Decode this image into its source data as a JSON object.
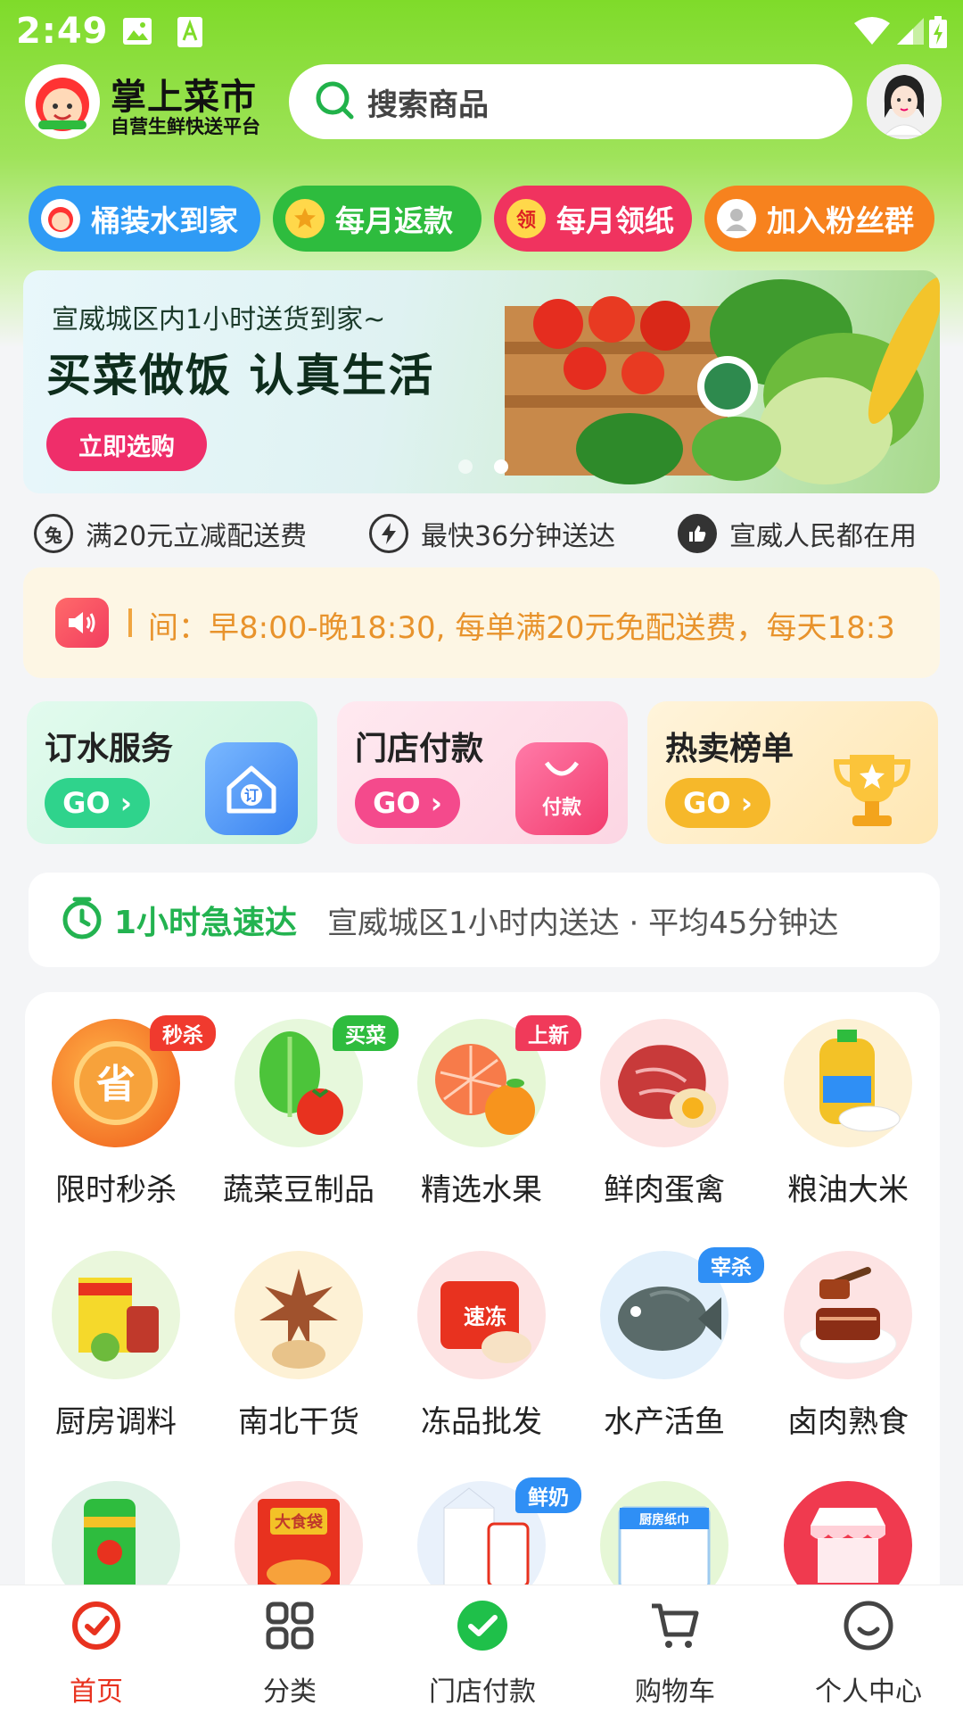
{
  "status_bar": {
    "time": "2:49"
  },
  "header": {
    "app_name": "掌上菜市",
    "app_subtitle": "自营生鲜快送平台",
    "search_placeholder": "搜索商品"
  },
  "quick_pills": [
    {
      "label": "桶装水到家",
      "color": "#2f9bf5"
    },
    {
      "label": "每月返款",
      "color": "#2ebc3e"
    },
    {
      "label": "每月领纸",
      "color": "#f0335f",
      "icon_text": "领"
    },
    {
      "label": "加入粉丝群",
      "color": "#f7821e"
    }
  ],
  "banner": {
    "line1": "宣威城区内1小时送货到家~",
    "line2": "买菜做饭 认真生活",
    "button": "立即选购"
  },
  "features": [
    {
      "icon_text": "兔",
      "label": "满20元立减配送费",
      "icon": "free-shipping-icon"
    },
    {
      "label": "最快36分钟送达",
      "icon": "lightning-icon"
    },
    {
      "label": "宣威人民都在用",
      "icon": "thumbs-up-icon"
    }
  ],
  "notice": {
    "text": "间：早8:00-晚18:30, 每单满20元免配送费，每天18:3"
  },
  "service_cards": [
    {
      "title": "订水服务",
      "go": "GO",
      "icon_text": "订",
      "color": "#2fd38c"
    },
    {
      "title": "门店付款",
      "go": "GO",
      "icon_text": "付款",
      "color": "#f44a8c"
    },
    {
      "title": "热卖榜单",
      "go": "GO",
      "color": "#f6b82a"
    }
  ],
  "express": {
    "title": "1小时急速达",
    "desc": "宣威城区1小时内送达 · 平均45分钟达"
  },
  "categories": [
    {
      "label": "限时秒杀",
      "badge": "秒杀",
      "badge_color": "#f03a2e",
      "icon_text": "省"
    },
    {
      "label": "蔬菜豆制品",
      "badge": "买菜",
      "badge_color": "#2ebc3e"
    },
    {
      "label": "精选水果",
      "badge": "上新",
      "badge_color": "#f03a5a"
    },
    {
      "label": "鲜肉蛋禽"
    },
    {
      "label": "粮油大米"
    },
    {
      "label": "厨房调料"
    },
    {
      "label": "南北干货"
    },
    {
      "label": "冻品批发",
      "icon_text": "速冻"
    },
    {
      "label": "水产活鱼",
      "badge": "宰杀",
      "badge_color": "#2f8ff5"
    },
    {
      "label": "卤肉熟食"
    },
    {
      "label": ""
    },
    {
      "label": "",
      "icon_text": "大食袋"
    },
    {
      "label": "",
      "badge": "鲜奶",
      "badge_color": "#2f8ff5"
    },
    {
      "label": "",
      "icon_text": "厨房纸巾"
    },
    {
      "label": ""
    }
  ],
  "tabs": [
    {
      "label": "首页",
      "active": true
    },
    {
      "label": "分类"
    },
    {
      "label": "门店付款"
    },
    {
      "label": "购物车"
    },
    {
      "label": "个人中心"
    }
  ]
}
